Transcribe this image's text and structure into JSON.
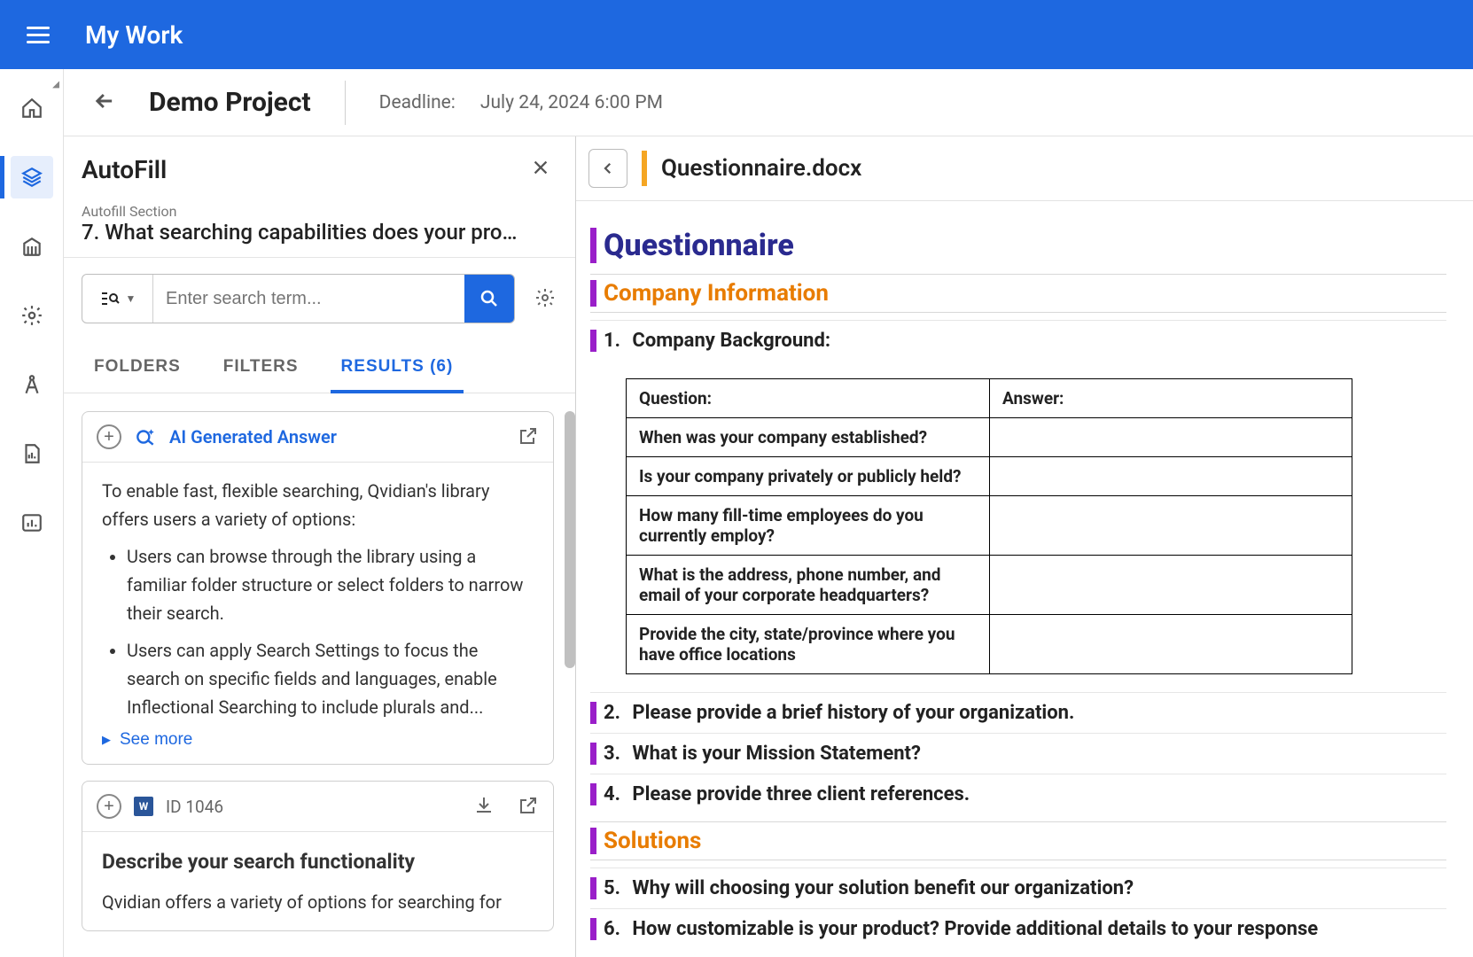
{
  "topbar": {
    "title": "My Work"
  },
  "project": {
    "name": "Demo Project",
    "deadline_label": "Deadline:",
    "deadline_value": "July 24, 2024 6:00 PM"
  },
  "autofill": {
    "title": "AutoFill",
    "section_label": "Autofill Section",
    "section_title": "7. What searching capabilities does your pro…",
    "search_placeholder": "Enter search term...",
    "tabs": {
      "folders": "FOLDERS",
      "filters": "FILTERS",
      "results": "RESULTS (6)"
    },
    "ai": {
      "label": "AI Generated Answer",
      "intro": "To enable fast, flexible searching, Qvidian's library offers users a variety of options:",
      "bullets": [
        "Users can browse through the library using a familiar folder structure or select folders to narrow their search.",
        "Users can apply Search Settings to focus the search on specific fields and languages, enable Inflectional Searching to include plurals and..."
      ],
      "see_more": "See more"
    },
    "result1": {
      "id_label": "ID 1046",
      "title": "Describe your search functionality",
      "excerpt": "Qvidian offers a variety of options for searching for"
    }
  },
  "document": {
    "filename": "Questionnaire.docx",
    "h1": "Questionnaire",
    "section_company": "Company Information",
    "q1": {
      "num": "1.",
      "text": "Company Background:"
    },
    "table": {
      "header_q": "Question:",
      "header_a": "Answer:",
      "rows": [
        "When was your company established?",
        "Is your company privately or publicly held?",
        "How many fill-time employees do you currently employ?",
        "What is the address, phone number, and email of your corporate headquarters?",
        "Provide the city, state/province where you have office locations"
      ]
    },
    "q2": {
      "num": "2.",
      "text": "Please provide a brief history of your organization."
    },
    "q3": {
      "num": "3.",
      "text": "What is your Mission Statement?"
    },
    "q4": {
      "num": "4.",
      "text": "Please provide three client references."
    },
    "section_solutions": "Solutions",
    "q5": {
      "num": "5.",
      "text": "Why will choosing your solution benefit our organization?"
    },
    "q6": {
      "num": "6.",
      "text": "How customizable is your product? Provide additional details to your response"
    }
  }
}
